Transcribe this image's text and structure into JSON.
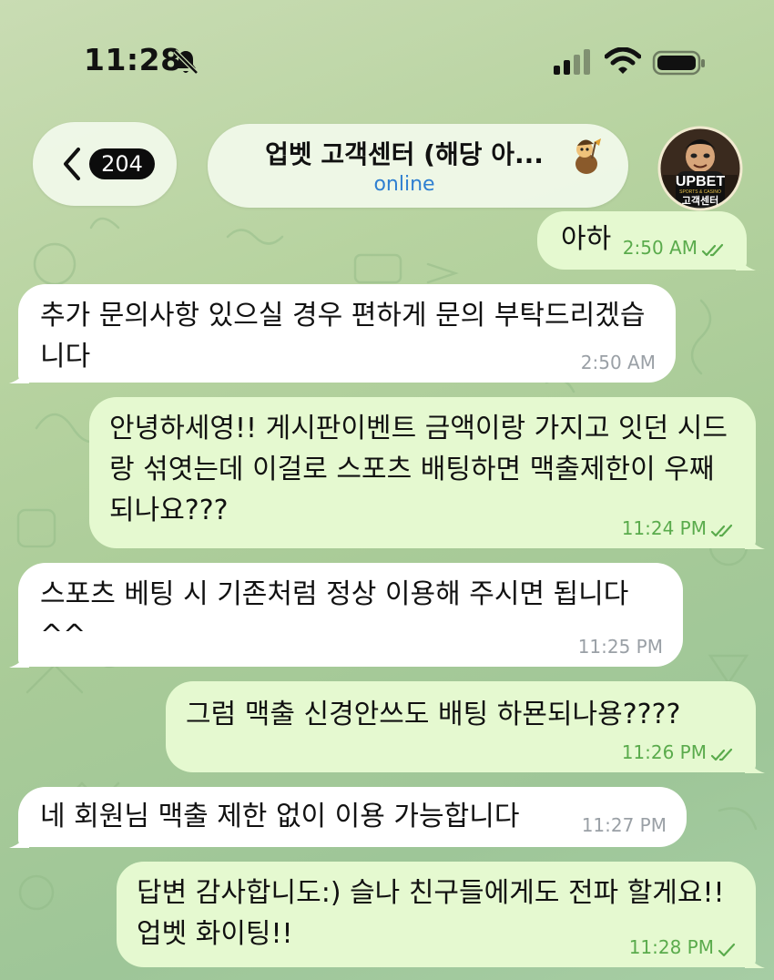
{
  "status_bar": {
    "time": "11:28",
    "icons": [
      "bell-slash-icon",
      "signal-icon",
      "wifi-icon",
      "battery-icon"
    ]
  },
  "header": {
    "back_icon": "chevron-left-icon",
    "unread_count": "204",
    "title": "업벳 고객센터 (해당 아...",
    "status": "online",
    "title_emoji": "cartoon-character-emoji",
    "avatar": {
      "logo_text": "UPBET",
      "logo_subtext": "SPORTS & CASINO",
      "caption": "고객센터"
    }
  },
  "messages": [
    {
      "direction": "outgoing",
      "text": "아하",
      "time": "2:50 AM",
      "status": "read"
    },
    {
      "direction": "incoming",
      "text": "추가 문의사항 있으실 경우 편하게 문의 부탁드리겠습니다",
      "time": "2:50 AM"
    },
    {
      "direction": "outgoing",
      "text": "안녕하세영!! 게시판이벤트 금액이랑 가지고 잇던 시드랑 섞엿는데 이걸로 스포츠 배팅하면 맥출제한이 우째되나요???",
      "time": "11:24 PM",
      "status": "read"
    },
    {
      "direction": "incoming",
      "text": "스포츠 베팅 시 기존처럼 정상 이용해 주시면 됩니다^^",
      "time": "11:25 PM"
    },
    {
      "direction": "outgoing",
      "text": "그럼 맥출 신경안쓰도 배팅 하묜되나용????",
      "time": "11:26 PM",
      "status": "read"
    },
    {
      "direction": "incoming",
      "text": "네 회원님 맥출 제한 없이 이용 가능합니다",
      "time": "11:27 PM"
    },
    {
      "direction": "outgoing",
      "text": "답변 감사합니도:) 슬나 친구들에게도 전파 할게요!! 업벳 화이팅!!",
      "time": "11:28 PM",
      "status": "sent"
    }
  ],
  "colors": {
    "background": "#b7d3a0",
    "incoming_bubble": "#ffffff",
    "outgoing_bubble": "#e5f9d0",
    "outgoing_meta": "#5aab4c",
    "online_status": "#2e7fd1"
  }
}
